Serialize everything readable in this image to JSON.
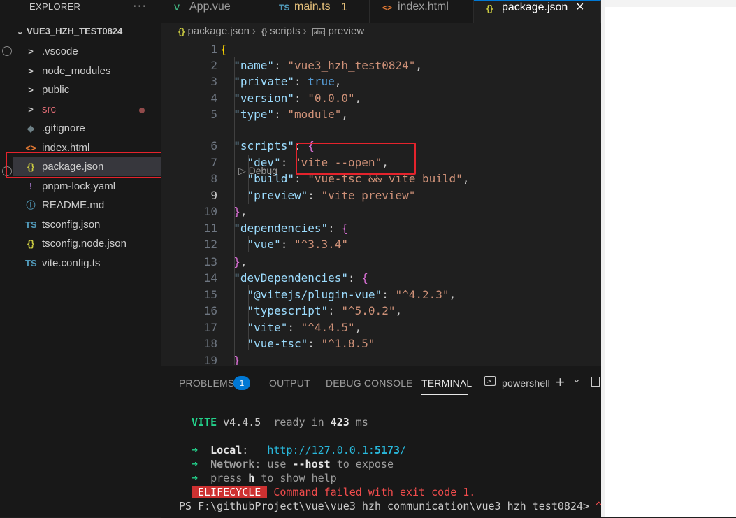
{
  "explorer": {
    "title": "EXPLORER",
    "more": "···",
    "root": "VUE3_HZH_TEST0824",
    "items": [
      {
        "label": ".vscode",
        "icon": ">",
        "color": "#cccccc",
        "iconColor": "#cccccc"
      },
      {
        "label": "node_modules",
        "icon": ">",
        "color": "#cccccc",
        "iconColor": "#cccccc"
      },
      {
        "label": "public",
        "icon": ">",
        "color": "#cccccc",
        "iconColor": "#cccccc"
      },
      {
        "label": "src",
        "icon": ">",
        "color": "#e06c75",
        "iconColor": "#cccccc"
      },
      {
        "label": ".gitignore",
        "icon": "◆",
        "color": "#cccccc",
        "iconColor": "#6d8086"
      },
      {
        "label": "index.html",
        "icon": "<>",
        "color": "#cccccc",
        "iconColor": "#e37933"
      },
      {
        "label": "package.json",
        "icon": "{}",
        "color": "#cccccc",
        "iconColor": "#cbcb41"
      },
      {
        "label": "pnpm-lock.yaml",
        "icon": "!",
        "color": "#cccccc",
        "iconColor": "#a074c4"
      },
      {
        "label": "README.md",
        "icon": "ⓘ",
        "color": "#cccccc",
        "iconColor": "#519aba"
      },
      {
        "label": "tsconfig.json",
        "icon": "TS",
        "color": "#cccccc",
        "iconColor": "#519aba"
      },
      {
        "label": "tsconfig.node.json",
        "icon": "{}",
        "color": "#cccccc",
        "iconColor": "#cbcb41"
      },
      {
        "label": "vite.config.ts",
        "icon": "TS",
        "color": "#cccccc",
        "iconColor": "#519aba"
      }
    ]
  },
  "tabs": [
    {
      "label": "App.vue",
      "icon": "V",
      "iconColor": "#41b883"
    },
    {
      "label": "main.ts",
      "icon": "TS",
      "iconColor": "#519aba",
      "badge": "1"
    },
    {
      "label": "index.html",
      "icon": "<>",
      "iconColor": "#e37933"
    },
    {
      "label": "package.json",
      "icon": "{}",
      "iconColor": "#cbcb41",
      "close": "×"
    }
  ],
  "breadcrumbs": [
    "package.json",
    "scripts",
    "preview"
  ],
  "codelens": "▷ Debug",
  "code": [
    {
      "n": "1",
      "parts": [
        [
          "br1",
          "{"
        ]
      ]
    },
    {
      "n": "2",
      "parts": [
        [
          "p",
          "  "
        ],
        [
          "k",
          "\"name\""
        ],
        [
          "p",
          ": "
        ],
        [
          "s",
          "\"vue3_hzh_test0824\""
        ],
        [
          "p",
          ","
        ]
      ]
    },
    {
      "n": "3",
      "parts": [
        [
          "p",
          "  "
        ],
        [
          "k",
          "\"private\""
        ],
        [
          "p",
          ": "
        ],
        [
          "b",
          "true"
        ],
        [
          "p",
          ","
        ]
      ]
    },
    {
      "n": "4",
      "parts": [
        [
          "p",
          "  "
        ],
        [
          "k",
          "\"version\""
        ],
        [
          "p",
          ": "
        ],
        [
          "s",
          "\"0.0.0\""
        ],
        [
          "p",
          ","
        ]
      ]
    },
    {
      "n": "5",
      "parts": [
        [
          "p",
          "  "
        ],
        [
          "k",
          "\"type\""
        ],
        [
          "p",
          ": "
        ],
        [
          "s",
          "\"module\""
        ],
        [
          "p",
          ","
        ]
      ]
    },
    {
      "n": "6",
      "parts": [
        [
          "p",
          "  "
        ],
        [
          "k",
          "\"scripts\""
        ],
        [
          "p",
          ": "
        ],
        [
          "br2",
          "{"
        ]
      ]
    },
    {
      "n": "7",
      "parts": [
        [
          "p",
          "    "
        ],
        [
          "k",
          "\"dev\""
        ],
        [
          "p",
          ": "
        ],
        [
          "s",
          "\"vite --open\""
        ],
        [
          "p",
          ","
        ]
      ]
    },
    {
      "n": "8",
      "parts": [
        [
          "p",
          "    "
        ],
        [
          "k",
          "\"build\""
        ],
        [
          "p",
          ": "
        ],
        [
          "s",
          "\"vue-tsc && vite build\""
        ],
        [
          "p",
          ","
        ]
      ]
    },
    {
      "n": "9",
      "parts": [
        [
          "p",
          "    "
        ],
        [
          "k",
          "\"preview\""
        ],
        [
          "p",
          ": "
        ],
        [
          "s",
          "\"vite preview\""
        ]
      ]
    },
    {
      "n": "10",
      "parts": [
        [
          "p",
          "  "
        ],
        [
          "br2",
          "}"
        ],
        [
          "p",
          ","
        ]
      ]
    },
    {
      "n": "11",
      "parts": [
        [
          "p",
          "  "
        ],
        [
          "k",
          "\"dependencies\""
        ],
        [
          "p",
          ": "
        ],
        [
          "br2",
          "{"
        ]
      ]
    },
    {
      "n": "12",
      "parts": [
        [
          "p",
          "    "
        ],
        [
          "k",
          "\"vue\""
        ],
        [
          "p",
          ": "
        ],
        [
          "s",
          "\"^3.3.4\""
        ]
      ]
    },
    {
      "n": "13",
      "parts": [
        [
          "p",
          "  "
        ],
        [
          "br2",
          "}"
        ],
        [
          "p",
          ","
        ]
      ]
    },
    {
      "n": "14",
      "parts": [
        [
          "p",
          "  "
        ],
        [
          "k",
          "\"devDependencies\""
        ],
        [
          "p",
          ": "
        ],
        [
          "br2",
          "{"
        ]
      ]
    },
    {
      "n": "15",
      "parts": [
        [
          "p",
          "    "
        ],
        [
          "k",
          "\"@vitejs/plugin-vue\""
        ],
        [
          "p",
          ": "
        ],
        [
          "s",
          "\"^4.2.3\""
        ],
        [
          "p",
          ","
        ]
      ]
    },
    {
      "n": "16",
      "parts": [
        [
          "p",
          "    "
        ],
        [
          "k",
          "\"typescript\""
        ],
        [
          "p",
          ": "
        ],
        [
          "s",
          "\"^5.0.2\""
        ],
        [
          "p",
          ","
        ]
      ]
    },
    {
      "n": "17",
      "parts": [
        [
          "p",
          "    "
        ],
        [
          "k",
          "\"vite\""
        ],
        [
          "p",
          ": "
        ],
        [
          "s",
          "\"^4.4.5\""
        ],
        [
          "p",
          ","
        ]
      ]
    },
    {
      "n": "18",
      "parts": [
        [
          "p",
          "    "
        ],
        [
          "k",
          "\"vue-tsc\""
        ],
        [
          "p",
          ": "
        ],
        [
          "s",
          "\"^1.8.5\""
        ]
      ]
    },
    {
      "n": "19",
      "parts": [
        [
          "p",
          "  "
        ],
        [
          "br2",
          "}"
        ]
      ]
    }
  ],
  "panel": {
    "tabs": [
      "PROBLEMS",
      "OUTPUT",
      "DEBUG CONSOLE",
      "TERMINAL"
    ],
    "problems_count": "1",
    "shell": "powershell",
    "add": "+",
    "chevron": "⌄"
  },
  "terminal": [
    [
      [
        "#23d18b",
        "VITE",
        true
      ],
      [
        "#cccccc",
        " v4.4.5  "
      ],
      [
        "#9d9d9d",
        "ready in "
      ],
      [
        "#e5e5e5",
        "423",
        true
      ],
      [
        "#9d9d9d",
        " ms"
      ]
    ],
    [],
    [
      [
        "#23d18b",
        "➜  "
      ],
      [
        "#e5e5e5",
        "Local",
        true
      ],
      [
        "#cccccc",
        ":   "
      ],
      [
        "#29b8db",
        "http://127.0.0.1:"
      ],
      [
        "#29b8db",
        "5173",
        true
      ],
      [
        "#29b8db",
        "/"
      ]
    ],
    [
      [
        "#23d18b",
        "➜  "
      ],
      [
        "#9d9d9d",
        "Network",
        true
      ],
      [
        "#9d9d9d",
        ": use "
      ],
      [
        "#e5e5e5",
        "--host",
        true
      ],
      [
        "#9d9d9d",
        " to expose"
      ]
    ],
    [
      [
        "#23d18b",
        "➜  "
      ],
      [
        "#9d9d9d",
        "press "
      ],
      [
        "#e5e5e5",
        "h",
        true
      ],
      [
        "#9d9d9d",
        " to show help"
      ]
    ],
    [
      [
        "BADGE",
        "ELIFECYCLE"
      ],
      [
        "#f14c4c",
        " Command failed with exit code 1."
      ]
    ],
    [
      [
        "#cccccc",
        "PS F:\\githubProject\\vue\\vue3_hzh_communication\\vue3_hzh_test0824> "
      ],
      [
        "#f14c4c",
        "^"
      ]
    ]
  ]
}
